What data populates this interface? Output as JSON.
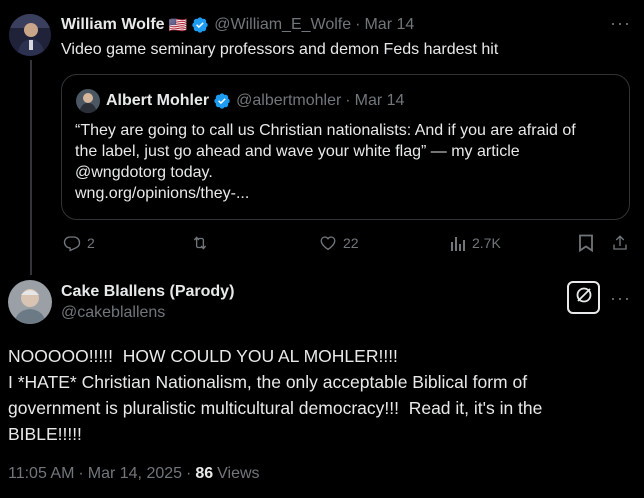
{
  "tweet1": {
    "name": "William Wolfe",
    "flag": "🇺🇸",
    "handle": "@William_E_Wolfe",
    "separator": "·",
    "date": "Mar 14",
    "text": "Video game seminary professors and demon Feds hardest hit"
  },
  "quote": {
    "name": "Albert Mohler",
    "handle": "@albertmohler",
    "separator": "·",
    "date": "Mar 14",
    "lines": [
      "“They are going to call us Christian nationalists: And if you are afraid of",
      "the label, just go ahead and wave your white flag” — my article",
      "@wngdotorg today.",
      "wng.org/opinions/they-..."
    ]
  },
  "actions": {
    "replies": "2",
    "retweets": "",
    "likes": "22",
    "views": "2.7K"
  },
  "tweet2": {
    "name": "Cake Blallens (Parody)",
    "handle": "@cakeblallens",
    "lines": [
      "NOOOOO!!!!!  HOW COULD YOU AL MOHLER!!!!",
      "I *HATE* Christian Nationalism, the only acceptable Biblical form of",
      "government is pluralistic multicultural democracy!!!  Read it, it's in the",
      "BIBLE!!!!!"
    ],
    "time": "11:05 AM",
    "separator": "·",
    "date": "Mar 14, 2025",
    "dot": "·",
    "view_count": "86",
    "views_label": "Views"
  },
  "colors": {
    "verified": "#1d9bf0",
    "muted": "#71767b",
    "border": "#2f3336"
  },
  "icons": [
    "verified-badge-icon",
    "reply-icon",
    "retweet-icon",
    "like-icon",
    "views-icon",
    "bookmark-icon",
    "share-icon",
    "grok-icon",
    "more-icon"
  ]
}
